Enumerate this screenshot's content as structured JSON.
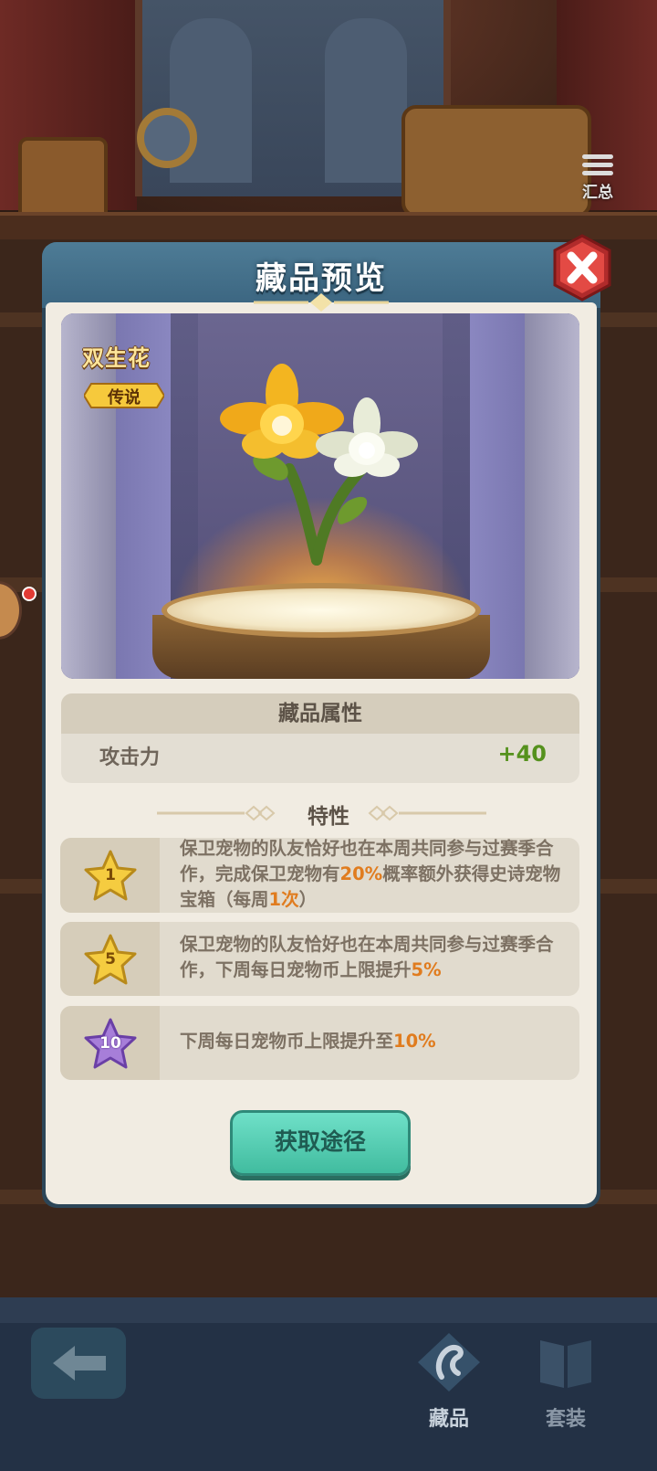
{
  "hud": {
    "summary_label": "汇总"
  },
  "dialog": {
    "title": "藏品预览",
    "item": {
      "name": "双生花",
      "rarity": "传说"
    },
    "attributes": {
      "header": "藏品属性",
      "rows": [
        {
          "label": "攻击力",
          "value": "+40"
        }
      ]
    },
    "traits_title": "特性",
    "traits": [
      {
        "level": "1",
        "star_color": "gold",
        "parts": [
          "保卫宠物的队友恰好也在本周共同参与过赛季合作，完成保卫宠物有",
          "20%",
          "概率额外获得史诗宠物宝箱（每周",
          "1次",
          "）"
        ]
      },
      {
        "level": "5",
        "star_color": "gold",
        "parts": [
          "保卫宠物的队友恰好也在本周共同参与过赛季合作，下周每日宠物币上限提升",
          "5%"
        ]
      },
      {
        "level": "10",
        "star_color": "purple",
        "parts": [
          "下周每日宠物币上限提升至",
          "10%"
        ]
      }
    ],
    "get_button": "获取途径"
  },
  "bottom_nav": {
    "tabs": [
      {
        "label": "藏品",
        "active": true
      },
      {
        "label": "套装",
        "active": false
      }
    ]
  },
  "colors": {
    "highlight": "#e07c1f",
    "attr_value": "#55911d",
    "button": "#41bc9f",
    "header": "#3b6580"
  }
}
